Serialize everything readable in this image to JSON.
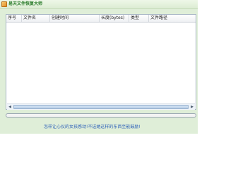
{
  "window": {
    "title": "易天文件恢复大师",
    "app_icon": "folder-icon"
  },
  "file_list": {
    "columns": [
      "序号",
      "文件名",
      "创建时间",
      "长度(bytes)",
      "类型",
      "文件路径"
    ],
    "rows": []
  },
  "progress": {
    "value": 0
  },
  "footer": {
    "link_text": "怎样让心仪的女孩感动!不送她这样的东西至能鼓励!"
  },
  "colors": {
    "title": "#2c7d2c",
    "link": "#2b5fb8",
    "window_bg": "#dfeed8"
  }
}
